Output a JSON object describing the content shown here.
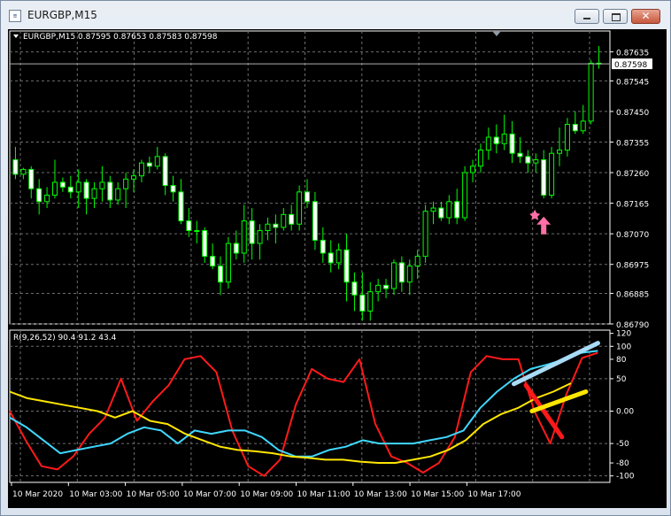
{
  "window": {
    "title": "EURGBP,M15",
    "icon_name": "chart-window-icon"
  },
  "chart_data": [
    {
      "type": "candlestick",
      "title": "EURGBP,M15  0.87595 0.87653 0.87583 0.87598",
      "symbol": "EURGBP",
      "timeframe": "M15",
      "ohlc": {
        "open": "0.87595",
        "high": "0.87653",
        "low": "0.87583",
        "close": "0.87598"
      },
      "ylim": [
        0.8679,
        0.877
      ],
      "y_ticks": [
        "0.87635",
        "0.87545",
        "0.87450",
        "0.87355",
        "0.87260",
        "0.87165",
        "0.87070",
        "0.86975",
        "0.86885",
        "0.86790"
      ],
      "current_price_label": "0.87598",
      "current_price": 0.87598,
      "grid": true,
      "colors": {
        "up_body": "#000000",
        "up_outline": "#00ff00",
        "down_body": "#ffffff",
        "wick": "#00ff00",
        "grid": "#6e6e6e",
        "text": "#ffffff",
        "price_line": "#b0b0b0",
        "marker": "#ff6fa8"
      },
      "candles": [
        [
          0.873,
          0.8734,
          0.8724,
          0.87255
        ],
        [
          0.87255,
          0.87275,
          0.8724,
          0.8727
        ],
        [
          0.8727,
          0.8728,
          0.8718,
          0.8721
        ],
        [
          0.8721,
          0.8724,
          0.8713,
          0.8717
        ],
        [
          0.8717,
          0.87215,
          0.8715,
          0.8719
        ],
        [
          0.8719,
          0.873,
          0.8718,
          0.8723
        ],
        [
          0.8723,
          0.87245,
          0.872,
          0.87215
        ],
        [
          0.87215,
          0.8725,
          0.8718,
          0.872
        ],
        [
          0.872,
          0.8727,
          0.8715,
          0.8723
        ],
        [
          0.8723,
          0.8724,
          0.8713,
          0.8718
        ],
        [
          0.8718,
          0.8723,
          0.8715,
          0.8721
        ],
        [
          0.8721,
          0.8728,
          0.8717,
          0.8723
        ],
        [
          0.8723,
          0.8725,
          0.8715,
          0.87175
        ],
        [
          0.87175,
          0.8723,
          0.8716,
          0.8721
        ],
        [
          0.8721,
          0.8726,
          0.8715,
          0.8724
        ],
        [
          0.8724,
          0.8727,
          0.872,
          0.8725
        ],
        [
          0.8725,
          0.873,
          0.8723,
          0.8729
        ],
        [
          0.8729,
          0.8731,
          0.8726,
          0.8728
        ],
        [
          0.8728,
          0.8734,
          0.8727,
          0.8731
        ],
        [
          0.8731,
          0.8732,
          0.8719,
          0.8722
        ],
        [
          0.8722,
          0.8725,
          0.8717,
          0.872
        ],
        [
          0.872,
          0.8724,
          0.871,
          0.8711
        ],
        [
          0.8711,
          0.8715,
          0.8706,
          0.8708
        ],
        [
          0.8708,
          0.8711,
          0.8704,
          0.8708
        ],
        [
          0.8708,
          0.8709,
          0.8698,
          0.87
        ],
        [
          0.87,
          0.8704,
          0.8696,
          0.8697
        ],
        [
          0.8697,
          0.87,
          0.8688,
          0.8692
        ],
        [
          0.8692,
          0.8706,
          0.869,
          0.8704
        ],
        [
          0.8704,
          0.8708,
          0.8699,
          0.8701
        ],
        [
          0.8701,
          0.8716,
          0.8698,
          0.8711
        ],
        [
          0.8711,
          0.8715,
          0.8699,
          0.8704
        ],
        [
          0.8704,
          0.871,
          0.8699,
          0.8708
        ],
        [
          0.8708,
          0.8712,
          0.8705,
          0.871
        ],
        [
          0.871,
          0.8713,
          0.8704,
          0.8709
        ],
        [
          0.8709,
          0.8715,
          0.8708,
          0.8713
        ],
        [
          0.8713,
          0.8716,
          0.8708,
          0.871
        ],
        [
          0.871,
          0.8722,
          0.8708,
          0.872
        ],
        [
          0.872,
          0.8724,
          0.8715,
          0.8717
        ],
        [
          0.8717,
          0.872,
          0.8702,
          0.8705
        ],
        [
          0.8705,
          0.8709,
          0.8698,
          0.8701
        ],
        [
          0.8701,
          0.8705,
          0.8695,
          0.8698
        ],
        [
          0.8698,
          0.8704,
          0.8696,
          0.8702
        ],
        [
          0.8702,
          0.8707,
          0.8686,
          0.8692
        ],
        [
          0.8692,
          0.8695,
          0.8683,
          0.8688
        ],
        [
          0.8688,
          0.8695,
          0.868,
          0.8683
        ],
        [
          0.8683,
          0.8692,
          0.868,
          0.8689
        ],
        [
          0.8689,
          0.8693,
          0.8686,
          0.8691
        ],
        [
          0.8691,
          0.8693,
          0.8687,
          0.869
        ],
        [
          0.869,
          0.8699,
          0.8688,
          0.8698
        ],
        [
          0.8698,
          0.87,
          0.8689,
          0.8692
        ],
        [
          0.8692,
          0.8699,
          0.8688,
          0.8697
        ],
        [
          0.8697,
          0.8702,
          0.8693,
          0.87
        ],
        [
          0.87,
          0.8716,
          0.8698,
          0.8714
        ],
        [
          0.8714,
          0.8717,
          0.871,
          0.8715
        ],
        [
          0.8715,
          0.8717,
          0.8711,
          0.8712
        ],
        [
          0.8712,
          0.8719,
          0.871,
          0.8717
        ],
        [
          0.8717,
          0.8721,
          0.871,
          0.8712
        ],
        [
          0.8712,
          0.8728,
          0.8711,
          0.8726
        ],
        [
          0.8726,
          0.873,
          0.8723,
          0.8728
        ],
        [
          0.8728,
          0.8735,
          0.8726,
          0.8733
        ],
        [
          0.8733,
          0.874,
          0.873,
          0.8737
        ],
        [
          0.8737,
          0.8741,
          0.8732,
          0.8735
        ],
        [
          0.8735,
          0.8744,
          0.8733,
          0.8738
        ],
        [
          0.8738,
          0.8742,
          0.8729,
          0.8732
        ],
        [
          0.8732,
          0.8737,
          0.8729,
          0.8731
        ],
        [
          0.8731,
          0.8733,
          0.8726,
          0.8729
        ],
        [
          0.8729,
          0.8732,
          0.8726,
          0.873
        ],
        [
          0.873,
          0.8733,
          0.8718,
          0.8719
        ],
        [
          0.8719,
          0.8734,
          0.8718,
          0.8732
        ],
        [
          0.8732,
          0.874,
          0.8728,
          0.8733
        ],
        [
          0.8733,
          0.8743,
          0.8731,
          0.8741
        ],
        [
          0.8741,
          0.8745,
          0.8738,
          0.8739
        ],
        [
          0.8739,
          0.8747,
          0.8738,
          0.8742
        ],
        [
          0.8742,
          0.8761,
          0.8741,
          0.876
        ],
        [
          0.876,
          0.87653,
          0.87583,
          0.87598
        ]
      ],
      "markers": [
        {
          "type": "arrow-up",
          "candle_index": 67,
          "price": 0.8714
        }
      ]
    },
    {
      "type": "line",
      "title": "R(9,26,52) 90.4 91.2 43.4",
      "ylim": [
        -110,
        125
      ],
      "y_ticks": [
        "120",
        "100",
        "80",
        "50",
        "0.00",
        "-50",
        "-80",
        "-100"
      ],
      "x_labels": [
        "10 Mar 2020",
        "10 Mar 03:00",
        "10 Mar 05:00",
        "10 Mar 07:00",
        "10 Mar 09:00",
        "10 Mar 11:00",
        "10 Mar 13:00",
        "10 Mar 15:00",
        "10 Mar 17:00"
      ],
      "series": [
        {
          "color": "#ff1a1a",
          "values": [
            0,
            -45,
            -85,
            -90,
            -70,
            -35,
            -10,
            50,
            -15,
            15,
            40,
            80,
            85,
            60,
            -30,
            -85,
            -100,
            -75,
            10,
            65,
            50,
            45,
            80,
            -20,
            -70,
            -80,
            -95,
            -80,
            -40,
            60,
            85,
            80,
            80,
            0,
            -50,
            25,
            82,
            90
          ]
        },
        {
          "color": "#3fd8ff",
          "values": [
            -10,
            -25,
            -45,
            -65,
            -60,
            -55,
            -50,
            -35,
            -25,
            -30,
            -50,
            -30,
            -35,
            -30,
            -30,
            -40,
            -60,
            -70,
            -70,
            -60,
            -55,
            -45,
            -50,
            -50,
            -50,
            -45,
            -40,
            -30,
            5,
            30,
            50,
            65,
            72,
            80,
            90,
            93
          ]
        },
        {
          "color": "#ffe600",
          "values": [
            30,
            20,
            15,
            10,
            5,
            0,
            -10,
            0,
            -15,
            -20,
            -35,
            -45,
            -55,
            -60,
            -62,
            -65,
            -70,
            -72,
            -75,
            -75,
            -78,
            -80,
            -80,
            -75,
            -70,
            -60,
            -45,
            -20,
            -5,
            5,
            20,
            30,
            43
          ]
        }
      ],
      "drawings": [
        {
          "color": "#a8dbf5",
          "from": [
            0.84,
            42
          ],
          "to": [
            0.98,
            105
          ]
        },
        {
          "color": "#ff1a1a",
          "from": [
            0.86,
            40
          ],
          "to": [
            0.92,
            -40
          ]
        },
        {
          "color": "#ffe600",
          "from": [
            0.87,
            0
          ],
          "to": [
            0.96,
            30
          ]
        }
      ]
    }
  ]
}
